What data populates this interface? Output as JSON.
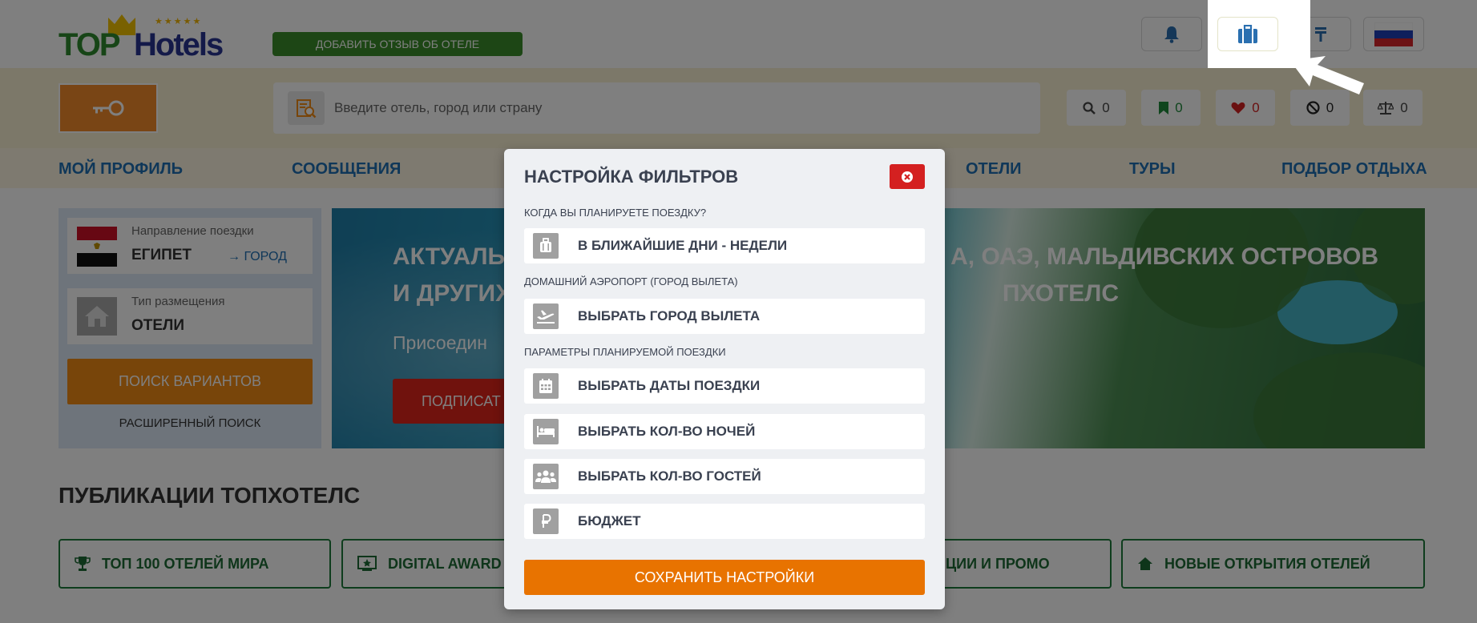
{
  "header": {
    "logo_top": "TOP",
    "logo_hotels": "Hotels",
    "logo_stars": "★★★★★",
    "review_button": "ДОБАВИТЬ ОТЗЫВ ОБ ОТЕЛЕ"
  },
  "search": {
    "placeholder": "Введите отель, город или страну"
  },
  "counters": {
    "search": "0",
    "bookmarks": "0",
    "favorites": "0",
    "blocked": "0",
    "compare": "0"
  },
  "nav": {
    "items": [
      "МОЙ ПРОФИЛЬ",
      "СООБЩЕНИЯ",
      "ОТЕЛИ",
      "ТУРЫ",
      "ПОДБОР ОТДЫХА"
    ]
  },
  "search_panel": {
    "direction_label": "Направление поездки",
    "direction_value": "ЕГИПЕТ",
    "city_link": "→ ГОРОД",
    "placement_label": "Тип размещения",
    "placement_value": "ОТЕЛИ",
    "find_button": "ПОИСК ВАРИАНТОВ",
    "advanced_link": "РАСШИРЕННЫЙ ПОИСК"
  },
  "hero": {
    "title": "АКТУАЛЬН                                        А, ОАЭ, МАЛЬДИВСКИХ ОСТРОВОВ И ДРУГИХ                                        ПХОТЕЛС",
    "title_line1_left": "АКТУАЛЬН",
    "title_line1_right": "А, ОАЭ, МАЛЬДИВСКИХ ОСТРОВОВ",
    "title_line2_left": "И ДРУГИХ",
    "title_line2_right": "ПХОТЕЛС",
    "subtitle": "Присоедин",
    "button": "ПОДПИСАТ"
  },
  "publications": {
    "title": "ПУБЛИКАЦИИ ТОПХОТЕЛС",
    "items": [
      "ТОП 100 ОТЕЛЕЙ МИРА",
      "DIGITAL AWARD",
      "ЦИИ И ПРОМО",
      "НОВЫЕ ОТКРЫТИЯ ОТЕЛЕЙ"
    ]
  },
  "modal": {
    "title": "НАСТРОЙКА ФИЛЬТРОВ",
    "section_when": "КОГДА ВЫ ПЛАНИРУЕТЕ ПОЕЗДКУ?",
    "option_when": "В БЛИЖАЙШИЕ ДНИ - НЕДЕЛИ",
    "section_airport": "ДОМАШНИЙ АЭРОПОРТ (ГОРОД ВЫЛЕТА)",
    "option_airport": "ВЫБРАТЬ ГОРОД ВЫЛЕТА",
    "section_params": "ПАРАМЕТРЫ ПЛАНИРУЕМОЙ ПОЕЗДКИ",
    "option_dates": "ВЫБРАТЬ ДАТЫ ПОЕЗДКИ",
    "option_nights": "ВЫБРАТЬ КОЛ-ВО НОЧЕЙ",
    "option_guests": "ВЫБРАТЬ КОЛ-ВО ГОСТЕЙ",
    "option_budget": "БЮДЖЕТ",
    "save_button": "СОХРАНИТЬ НАСТРОЙКИ"
  },
  "colors": {
    "accent_orange": "#e87300",
    "brand_green": "#3a8d2a",
    "nav_blue": "#1f6fb3",
    "close_red": "#d42020"
  }
}
